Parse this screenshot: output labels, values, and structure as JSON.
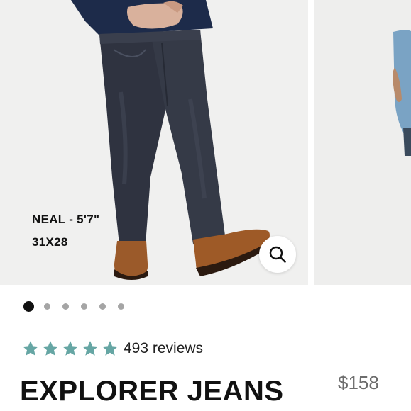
{
  "product": {
    "model_name": "NEAL - 5'7\"",
    "model_size": "31X28",
    "rating": 5,
    "reviews": "493 reviews",
    "title": "EXPLORER JEANS",
    "price": "$158"
  },
  "carousel": {
    "total_images": 6,
    "active_index": 0
  },
  "colors": {
    "star": "#66a6a4",
    "dot_active": "#111111",
    "dot_inactive": "#a5a5a5",
    "price": "#6d6d6d"
  },
  "icons": {
    "zoom": "magnifier-icon",
    "rating": "star-icon"
  }
}
